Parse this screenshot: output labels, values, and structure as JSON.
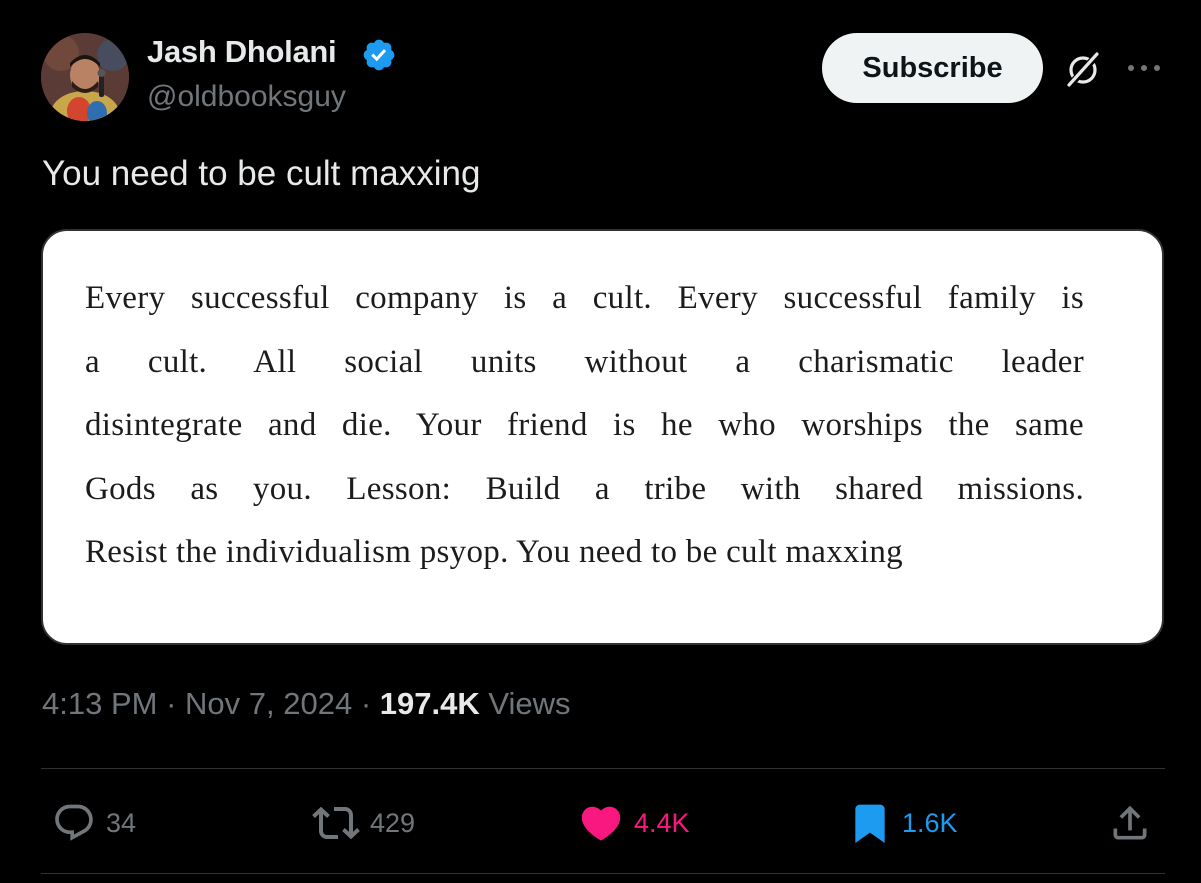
{
  "author": {
    "display_name": "Jash Dholani",
    "handle": "@oldbooksguy",
    "verified": true,
    "verified_color": "#1d9bf0"
  },
  "header_actions": {
    "subscribe_label": "Subscribe",
    "grok_icon": "grok-icon",
    "more_icon": "more-dots-icon"
  },
  "tweet": {
    "text": "You need to be cult maxxing",
    "media_text_lines": [
      "Every successful company is a cult. Every successful family is",
      "a cult. All social units without a charismatic leader",
      "disintegrate and die. Your friend is he who worships the same",
      "Gods as you. Lesson: Build a tribe with shared missions.",
      "Resist the individualism psyop. You need to be cult maxxing"
    ]
  },
  "meta": {
    "time": "4:13 PM",
    "separator": "·",
    "date": "Nov 7, 2024",
    "views_count": "197.4K",
    "views_label": "Views"
  },
  "actions": {
    "reply_count": "34",
    "retweet_count": "429",
    "like_count": "4.4K",
    "bookmark_count": "1.6K",
    "like_color": "#f91880",
    "bookmark_color": "#1d9bf0"
  }
}
